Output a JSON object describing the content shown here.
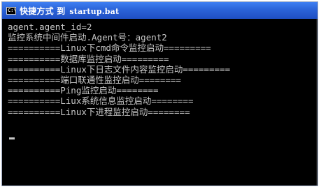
{
  "window": {
    "title_prefix": "快捷方式 到",
    "title_file": "startup.bat",
    "icon_label": "C:\\"
  },
  "console": {
    "lines": [
      "agent.agent_id=2",
      "监控系统中间件启动.Agent号：agent2",
      "==========Linux下cmd命令监控启动=========",
      "==========数据库监控启动=========",
      "==========Linux下日志文件内容监控启动=========",
      "==========端口联通性监控启动========",
      "==========Ping监控启动========",
      "==========Liux系统信息监控启动========",
      "==========Linux下进程监控启动========"
    ]
  },
  "colors": {
    "console_bg": "#000000",
    "console_fg": "#c8c8c8",
    "titlebar": "#2b63d8"
  }
}
